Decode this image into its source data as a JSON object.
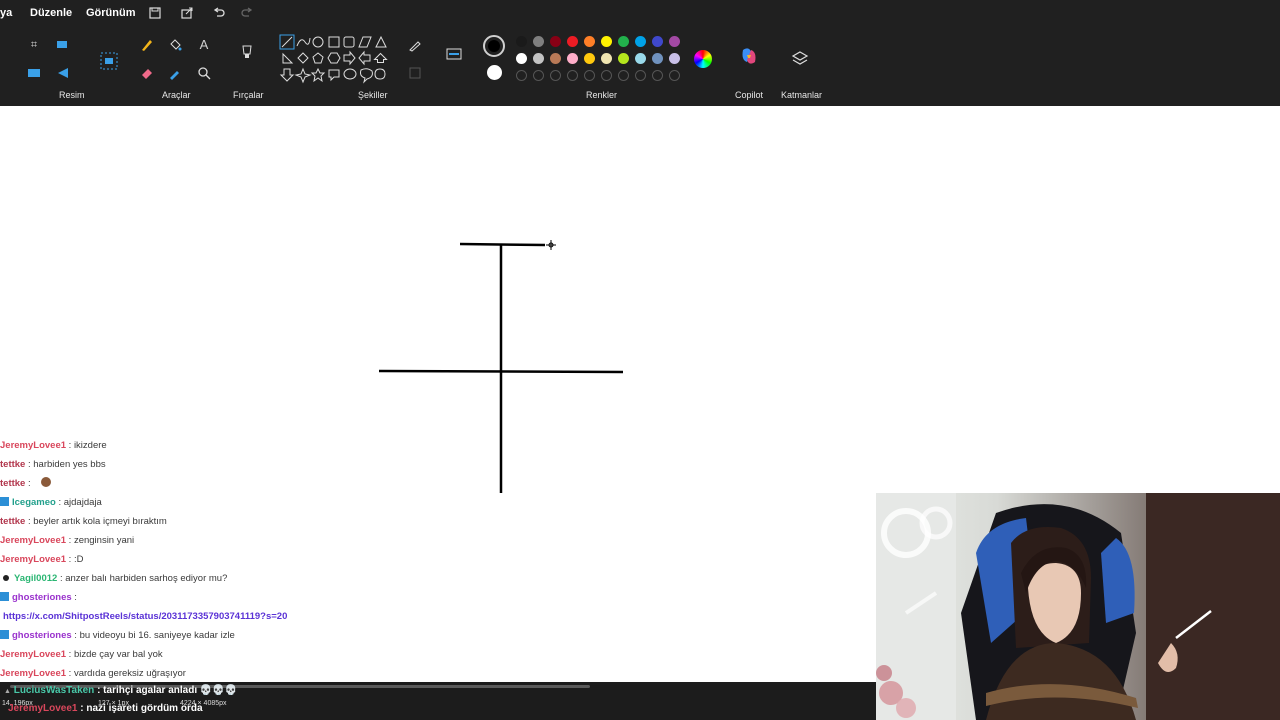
{
  "menubar": {
    "items": [
      "ya",
      "Düzenle",
      "Görünüm"
    ],
    "quick_access_icons": [
      "save-icon",
      "share-icon",
      "undo-icon",
      "redo-icon"
    ]
  },
  "ribbon": {
    "groups": [
      "Resim",
      "Araçlar",
      "Fırçalar",
      "Şekiller",
      "Renkler",
      "Copilot",
      "Katmanlar"
    ],
    "color_rows": [
      [
        "#1a1a1a",
        "#7f7f7f",
        "#880015",
        "#ed1c24",
        "#ff7f27",
        "#fff200",
        "#22b14c",
        "#00a2e8",
        "#3f48cc",
        "#a349a4"
      ],
      [
        "#ffffff",
        "#c3c3c3",
        "#b97a57",
        "#ffaec9",
        "#ffc90e",
        "#efe4b0",
        "#b5e61d",
        "#99d9ea",
        "#7092be",
        "#c8bfe7"
      ]
    ],
    "primary_color": "#000000",
    "secondary_color": "#ffffff"
  },
  "chat": {
    "messages": [
      {
        "user": "JeremyLovee1",
        "color": "#d9475c",
        "text": " : ikizdere"
      },
      {
        "user": "tettke",
        "color": "#b2374d",
        "text": " : harbiden yes bbs"
      },
      {
        "user": "tettke",
        "color": "#b2374d",
        "text": " : "
      },
      {
        "user": "Icegameo",
        "color": "#23a08c",
        "text": " : ajdajdaja"
      },
      {
        "user": "tettke",
        "color": "#b2374d",
        "text": " : beyler artık kola içmeyi bıraktım"
      },
      {
        "user": "JeremyLovee1",
        "color": "#d9475c",
        "text": " : zenginsin yani"
      },
      {
        "user": "JeremyLovee1",
        "color": "#d9475c",
        "text": " : :D"
      },
      {
        "user": "Yagil0012",
        "color": "#2bb673",
        "text": " : anzer balı harbiden sarhoş ediyor mu?"
      },
      {
        "user": "ghosteriones",
        "color": "#9a32cd",
        "text": " :"
      },
      {
        "user": "",
        "color": "#5a32d6",
        "text": "https://x.com/ShitpostReels/status/2031173357903741119?s=20"
      },
      {
        "user": "ghosteriones",
        "color": "#9a32cd",
        "text": " : bu videoyu bi 16. saniyeye kadar izle"
      },
      {
        "user": "JeremyLovee1",
        "color": "#d9475c",
        "text": " : bizde çay var bal yok"
      },
      {
        "user": "JeremyLovee1",
        "color": "#d9475c",
        "text": " : vardıda gereksiz uğraşıyor"
      }
    ]
  },
  "bottom": {
    "last_user": "LuciusWasTaken",
    "last_text": " : tarihçi agalar anladı",
    "last_emoji": "💀💀💀",
    "prev_user": "JeremyLovee1",
    "prev_text": " : nazi işareti gördüm orda",
    "status_pos": "14, 196px",
    "status_sel": "127 × 1px",
    "status_size": "4224 × 4085px"
  }
}
